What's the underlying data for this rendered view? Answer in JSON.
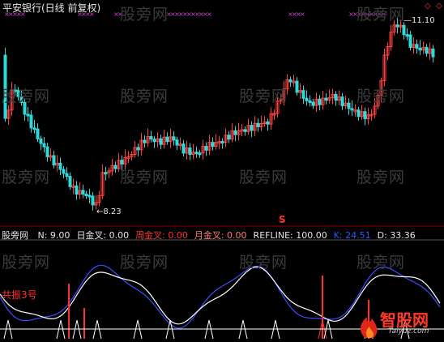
{
  "header": {
    "title": "平安银行(日线 前复权)",
    "high_marker": "11.10",
    "low_marker": "8.23",
    "signal_mark": "S"
  },
  "watermark": "股旁网",
  "indicator": {
    "name": "股旁网",
    "params": [
      {
        "label": "N:",
        "value": "9.00",
        "color": "#e6e6e6"
      },
      {
        "label": "日金叉:",
        "value": "0.00",
        "color": "#e6e6e6"
      },
      {
        "label": "周金叉:",
        "value": "0.00",
        "color": "#ff3333"
      },
      {
        "label": "月金叉:",
        "value": "0.00",
        "color": "#ff7777"
      },
      {
        "label": "REFLINE:",
        "value": "100.00",
        "color": "#e6e6e6"
      },
      {
        "label": "K:",
        "value": "24.51",
        "color": "#3355ff"
      },
      {
        "label": "D:",
        "value": "33.36",
        "color": "#e6e6e6"
      }
    ],
    "resonance_label": "共振3号"
  },
  "brand": {
    "name": "智股网",
    "url": "Taiyuz.com"
  },
  "colors": {
    "up": "#ff4040",
    "down": "#2fd9d9",
    "k_line": "#3a4cff",
    "d_line": "#ffffff",
    "cross": "#d040d0",
    "signal": "#ff3030"
  }
}
